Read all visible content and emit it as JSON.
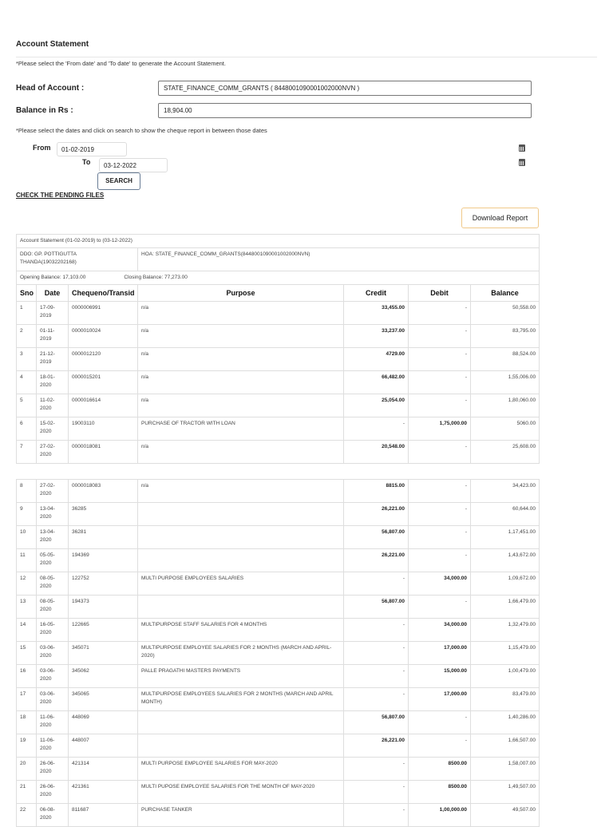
{
  "page": {
    "title": "Account Statement",
    "note1": "*Please select the 'From date' and 'To date' to generate the Account Statement.",
    "head_label": "Head of Account :",
    "head_value": "STATE_FINANCE_COMM_GRANTS ( 8448001090001002000NVN )",
    "balance_label": "Balance in Rs :",
    "balance_value": "18,904.00",
    "note2": "*Please select the dates and click on search to show the cheque report in between those dates",
    "from_label": "From",
    "from_value": "01-02-2019",
    "to_label": "To",
    "to_value": "03-12-2022",
    "search_label": "SEARCH",
    "pending_link": "CHECK THE PENDING FILES",
    "download_label": "Download Report"
  },
  "statement": {
    "period": "Account Statement (01-02-2019) to (03-12-2022)",
    "ddo": "DDO: GP. POTTIGUTTA THANDA(19032202168)",
    "hoa": "HOA: STATE_FINANCE_COMM_GRANTS(8448001090001002000NVN)",
    "opening": "Opening Balance: 17,103.00",
    "closing": "Closing Balance: 77,273.00",
    "columns": [
      "Sno",
      "Date",
      "Chequeno/Transid",
      "Purpose",
      "Credit",
      "Debit",
      "Balance"
    ],
    "rows_page1": [
      [
        "1",
        "17-09-2019",
        "0000006991",
        "n/a",
        "33,455.00",
        "-",
        "50,558.00"
      ],
      [
        "2",
        "01-11-2019",
        "0000010024",
        "n/a",
        "33,237.00",
        "-",
        "83,795.00"
      ],
      [
        "3",
        "21-12-2019",
        "0000012120",
        "n/a",
        "4729.00",
        "-",
        "88,524.00"
      ],
      [
        "4",
        "18-01-2020",
        "0000015201",
        "n/a",
        "66,482.00",
        "-",
        "1,55,006.00"
      ],
      [
        "5",
        "11-02-2020",
        "0000016614",
        "n/a",
        "25,054.00",
        "-",
        "1,80,060.00"
      ],
      [
        "6",
        "15-02-2020",
        "19003110",
        "PURCHASE OF TRACTOR WITH LOAN",
        "-",
        "1,75,000.00",
        "5060.00"
      ],
      [
        "7",
        "27-02-2020",
        "0000018081",
        "n/a",
        "20,548.00",
        "-",
        "25,608.00"
      ]
    ],
    "rows_page2": [
      [
        "8",
        "27-02-2020",
        "0000018083",
        "n/a",
        "8815.00",
        "-",
        "34,423.00"
      ],
      [
        "9",
        "13-04-2020",
        "36285",
        "",
        "26,221.00",
        "-",
        "60,644.00"
      ],
      [
        "10",
        "13-04-2020",
        "36281",
        "",
        "56,807.00",
        "-",
        "1,17,451.00"
      ],
      [
        "11",
        "05-05-2020",
        "194369",
        "",
        "26,221.00",
        "-",
        "1,43,672.00"
      ],
      [
        "12",
        "08-05-2020",
        "122752",
        "MULTI PURPOSE EMPLOYEES SALARIES",
        "-",
        "34,000.00",
        "1,09,672.00"
      ],
      [
        "13",
        "08-05-2020",
        "194373",
        "",
        "56,807.00",
        "-",
        "1,66,479.00"
      ],
      [
        "14",
        "16-05-2020",
        "122665",
        "MULTIPURPOSE STAFF SALARIES FOR 4 MONTHS",
        "-",
        "34,000.00",
        "1,32,479.00"
      ],
      [
        "15",
        "03-06-2020",
        "345071",
        "MULTIPURPOSE EMPLOYEE SALARIES FOR 2 MONTHS (MARCH AND APRIL-2020)",
        "-",
        "17,000.00",
        "1,15,479.00"
      ],
      [
        "16",
        "03-06-2020",
        "345062",
        "PALLE PRAGATHI MASTERS PAYMENTS",
        "-",
        "15,000.00",
        "1,00,479.00"
      ],
      [
        "17",
        "03-06-2020",
        "345065",
        "MULTIPURPOSE EMPLOYEES SALARIES FOR 2 MONTHS (MARCH AND APRIL MONTH)",
        "-",
        "17,000.00",
        "83,479.00"
      ],
      [
        "18",
        "11-06-2020",
        "448069",
        "",
        "56,807.00",
        "-",
        "1,40,286.00"
      ],
      [
        "19",
        "11-06-2020",
        "448007",
        "",
        "26,221.00",
        "-",
        "1,66,507.00"
      ],
      [
        "20",
        "26-06-2020",
        "421314",
        "MULTI PURPOSE EMPLOYEE SALARIES FOR MAY-2020",
        "-",
        "8500.00",
        "1,58,007.00"
      ],
      [
        "21",
        "26-06-2020",
        "421361",
        "MULTI PUPOSE EMPLOYEE SALARIES FOR THE MONTH OF MAY-2020",
        "-",
        "8500.00",
        "1,49,507.00"
      ],
      [
        "22",
        "06-08-2020",
        "811687",
        "PURCHASE TANKER",
        "-",
        "1,00,000.00",
        "49,507.00"
      ]
    ]
  }
}
